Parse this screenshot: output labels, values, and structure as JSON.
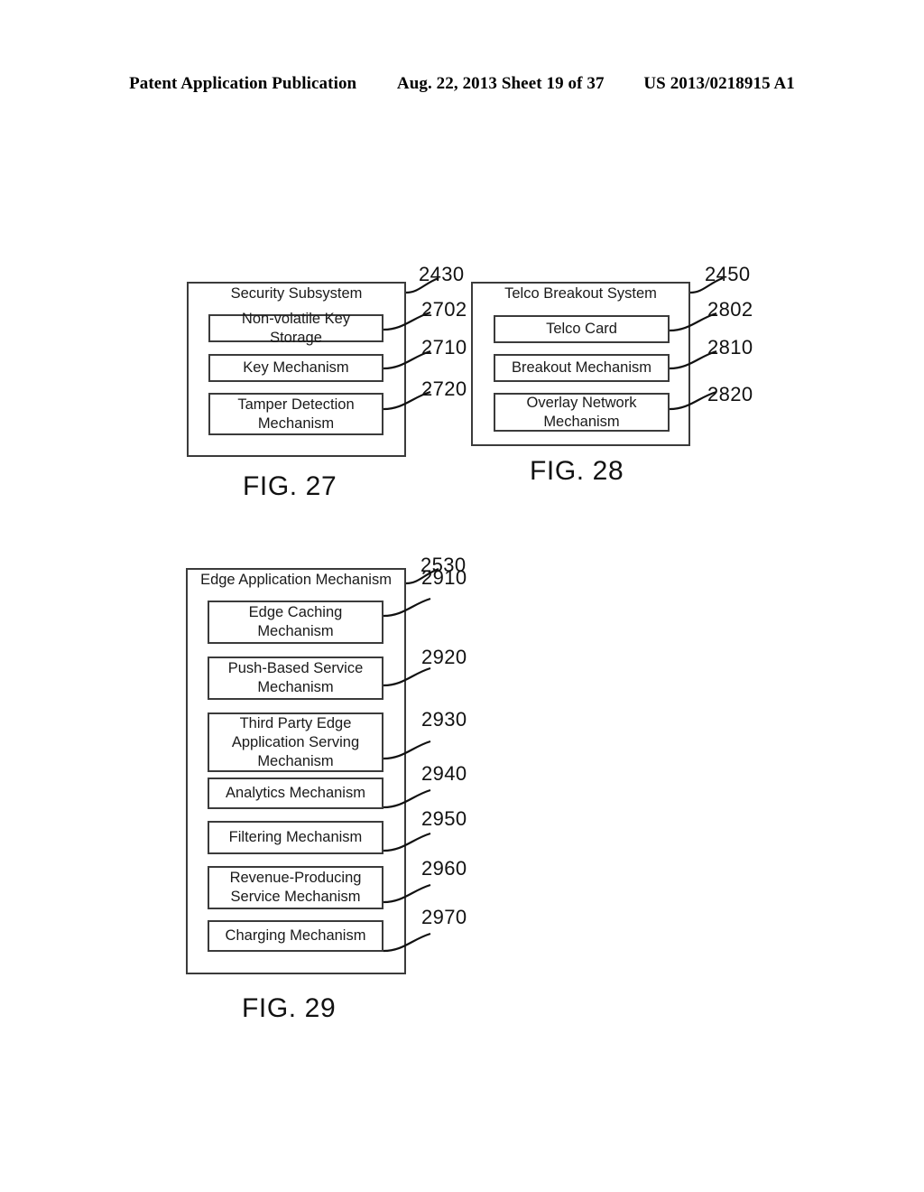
{
  "header": {
    "publication": "Patent Application Publication",
    "date_sheet": "Aug. 22, 2013  Sheet 19 of 37",
    "patent_number": "US 2013/0218915 A1"
  },
  "figures": [
    {
      "caption": "FIG. 27",
      "container": {
        "title": "Security Subsystem",
        "ref": "2430"
      },
      "blocks": [
        {
          "label": "Non-volatile Key Storage",
          "ref": "2702"
        },
        {
          "label": "Key Mechanism",
          "ref": "2710"
        },
        {
          "label": "Tamper Detection Mechanism",
          "ref": "2720"
        }
      ]
    },
    {
      "caption": "FIG. 28",
      "container": {
        "title": "Telco Breakout System",
        "ref": "2450"
      },
      "blocks": [
        {
          "label": "Telco Card",
          "ref": "2802"
        },
        {
          "label": "Breakout Mechanism",
          "ref": "2810"
        },
        {
          "label": "Overlay Network Mechanism",
          "ref": "2820"
        }
      ]
    },
    {
      "caption": "FIG. 29",
      "container": {
        "title": "Edge Application Mechanism",
        "ref": "2530"
      },
      "blocks": [
        {
          "label": "Edge Caching Mechanism",
          "ref": "2910"
        },
        {
          "label": "Push-Based Service Mechanism",
          "ref": "2920"
        },
        {
          "label": "Third Party Edge Application Serving Mechanism",
          "ref": "2930"
        },
        {
          "label": "Analytics Mechanism",
          "ref": "2940"
        },
        {
          "label": "Filtering Mechanism",
          "ref": "2950"
        },
        {
          "label": "Revenue-Producing Service Mechanism",
          "ref": "2960"
        },
        {
          "label": "Charging Mechanism",
          "ref": "2970"
        }
      ]
    }
  ],
  "colors": {
    "line": "#3b3b3b",
    "text": "#111111",
    "background": "#ffffff"
  }
}
